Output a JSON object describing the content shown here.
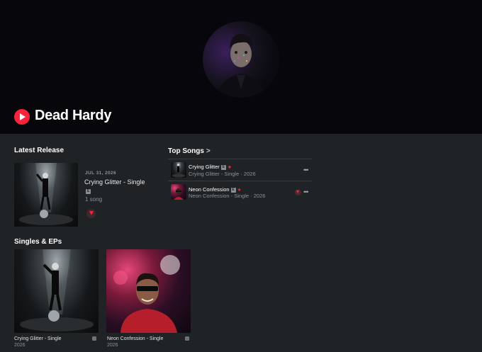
{
  "artist": {
    "name": "Dead Hardy"
  },
  "latest_release": {
    "heading": "Latest Release",
    "date": "JUL 31, 2026",
    "title": "Crying Glitter - Single",
    "count": "1 song"
  },
  "top_songs": {
    "heading": "Top Songs",
    "chevron": ">",
    "items": [
      {
        "title": "Crying Glitter",
        "subtitle": "Crying Glitter - Single · 2026",
        "more": "•••"
      },
      {
        "title": "Neon Confession",
        "subtitle": "Neon Confession - Single · 2026",
        "more": "•••"
      }
    ]
  },
  "singles": {
    "heading": "Singles & EPs",
    "items": [
      {
        "title": "Crying Glitter - Single",
        "year": "2026"
      },
      {
        "title": "Neon Confession - Single",
        "year": "2026"
      }
    ]
  },
  "colors": {
    "accent": "#fa233b",
    "background": "#1f2326",
    "hero": "#07060b"
  },
  "icons": [
    "play-icon",
    "explicit-icon",
    "favorite-star-icon",
    "download-icon",
    "more-icon",
    "chevron-right-icon"
  ]
}
